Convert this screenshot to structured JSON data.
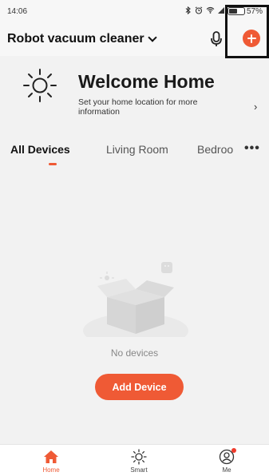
{
  "status_bar": {
    "time": "14:06",
    "battery": "57%",
    "battery_level": 0.57
  },
  "header": {
    "home_name": "Robot vacuum cleaner"
  },
  "welcome": {
    "title": "Welcome Home",
    "subtitle": "Set your home location for more information"
  },
  "tabs": [
    {
      "label": "All Devices",
      "active": true
    },
    {
      "label": "Living Room",
      "active": false
    },
    {
      "label": "Bedroo",
      "active": false
    }
  ],
  "empty_state": {
    "message": "No devices",
    "button_label": "Add Device"
  },
  "bottom_nav": [
    {
      "label": "Home",
      "icon": "home-icon",
      "active": true
    },
    {
      "label": "Smart",
      "icon": "sun-icon",
      "active": false
    },
    {
      "label": "Me",
      "icon": "user-icon",
      "active": false,
      "badge": true
    }
  ],
  "colors": {
    "accent": "#ef5a35",
    "background": "#f2f2f2"
  }
}
